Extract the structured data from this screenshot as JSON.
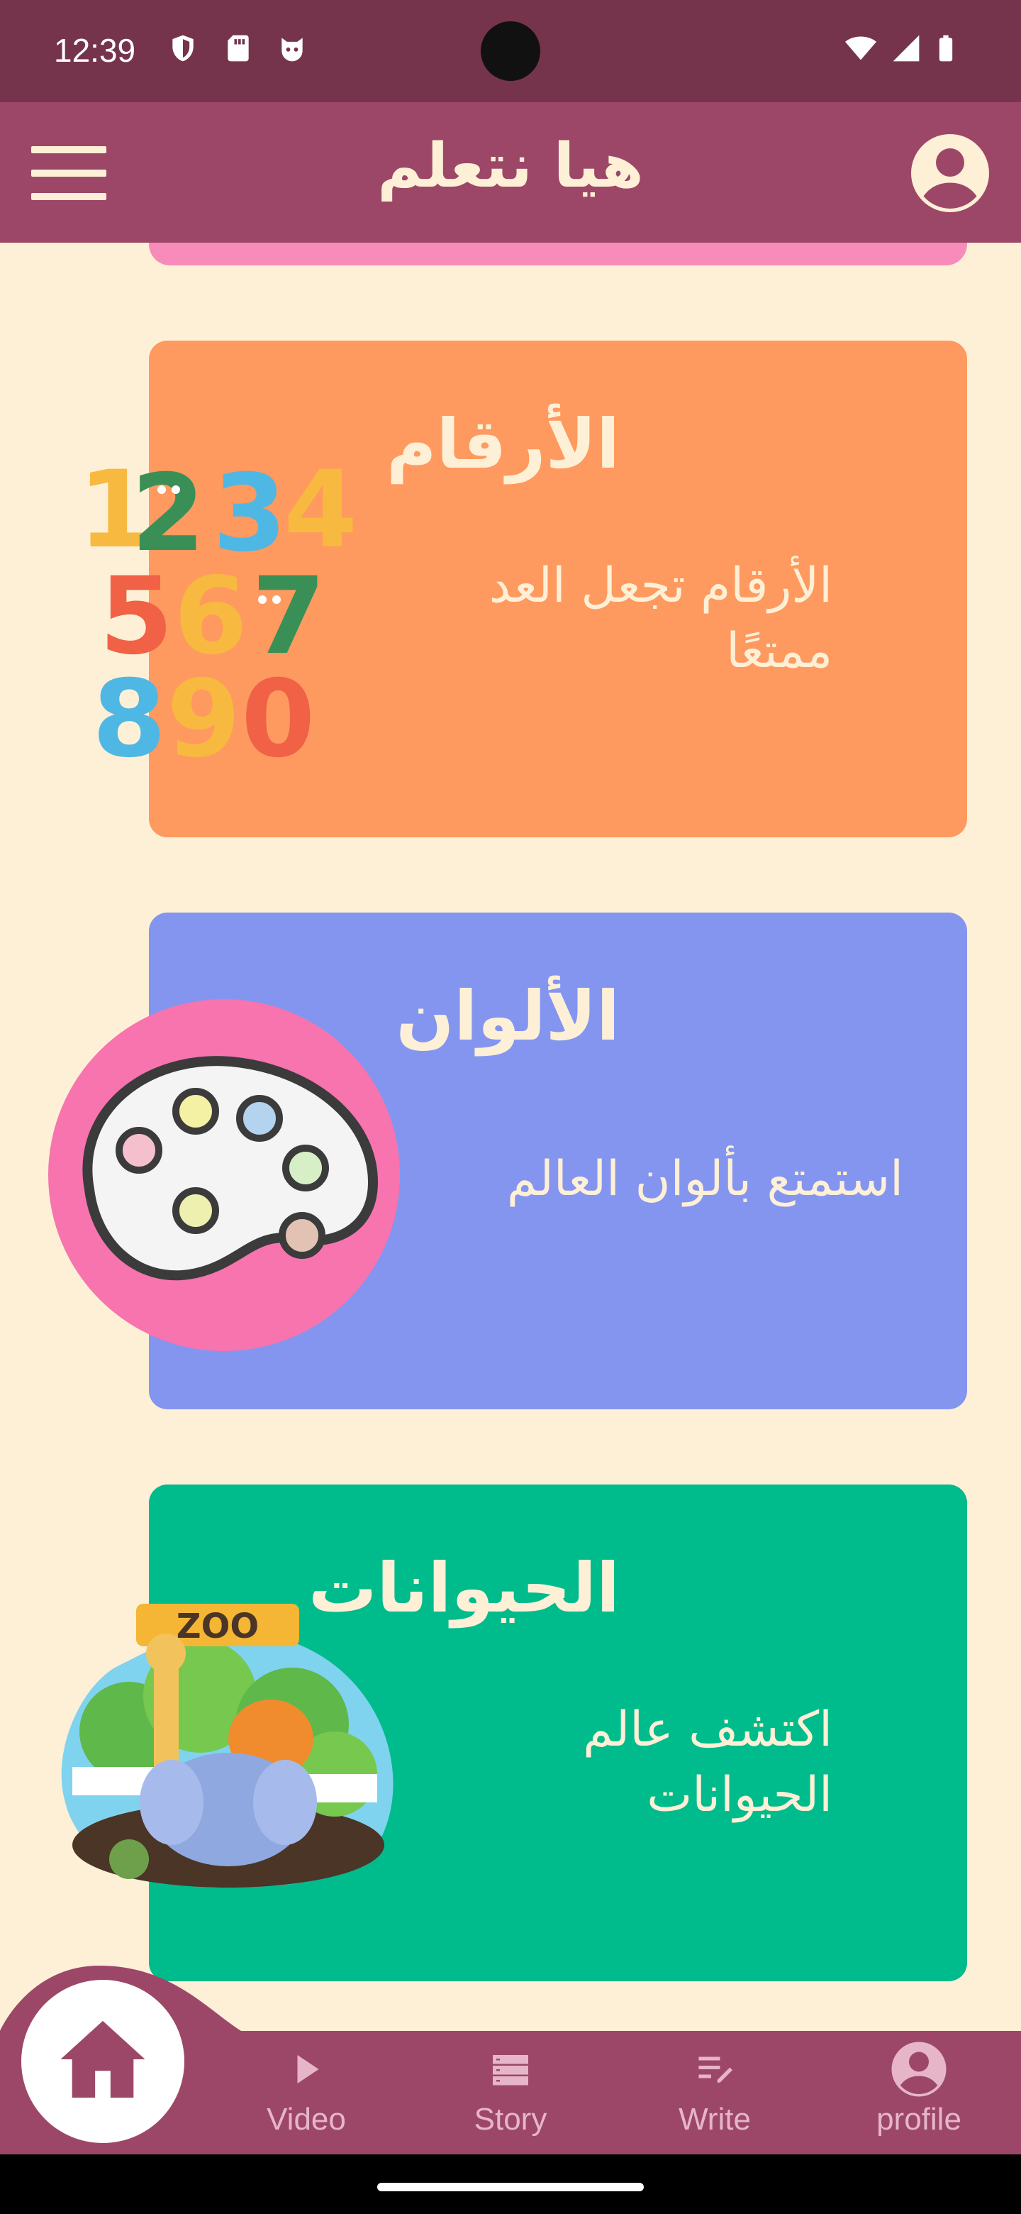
{
  "status_bar": {
    "time": "12:39",
    "icons": [
      "shield-icon",
      "sd-card-icon",
      "cat-face-icon",
      "wifi-icon",
      "signal-icon",
      "battery-icon"
    ]
  },
  "app_bar": {
    "title": "هيا نتعلم",
    "left_icon": "menu-icon",
    "right_icon": "account-circle-icon"
  },
  "cards": [
    {
      "title": "الأرقام",
      "description": "الأرقام تجعل العد ممتعًا",
      "color": "#fe9a5f",
      "image": "numbers-illustration"
    },
    {
      "title": "الألوان",
      "description": "استمتع بألوان العالم",
      "color": "#8495f0",
      "image": "paint-palette-illustration"
    },
    {
      "title": "الحيوانات",
      "description": "اكتشف عالم الحيوانات",
      "color": "#00bb8c",
      "image": "zoo-illustration"
    }
  ],
  "zoo_sign": "ZOO",
  "bottom_nav": {
    "home_icon": "home-icon",
    "items": [
      {
        "label": "Video",
        "icon": "play-icon"
      },
      {
        "label": "Story",
        "icon": "story-icon"
      },
      {
        "label": "Write",
        "icon": "write-icon"
      },
      {
        "label": "profile",
        "icon": "profile-icon"
      }
    ]
  },
  "colors": {
    "status_bar": "#76344c",
    "app_bar": "#9d4768",
    "background": "#fdf0d6",
    "text_light": "#fdf0d6"
  }
}
